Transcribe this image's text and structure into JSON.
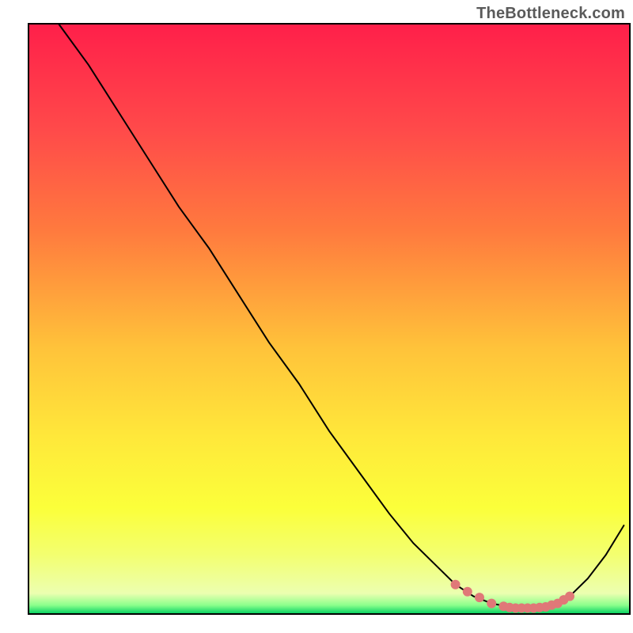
{
  "watermark": "TheBottleneck.com",
  "chart_data": {
    "type": "line",
    "title": "",
    "xlabel": "",
    "ylabel": "",
    "xlim": [
      0,
      100
    ],
    "ylim": [
      0,
      100
    ],
    "grid": false,
    "legend": false,
    "background_gradient": {
      "direction": "vertical",
      "stops": [
        {
          "offset": 0.0,
          "color": "#ff1f4a"
        },
        {
          "offset": 0.18,
          "color": "#ff4a4a"
        },
        {
          "offset": 0.35,
          "color": "#ff7a3e"
        },
        {
          "offset": 0.55,
          "color": "#ffc33a"
        },
        {
          "offset": 0.7,
          "color": "#ffe83a"
        },
        {
          "offset": 0.82,
          "color": "#fbff3a"
        },
        {
          "offset": 0.9,
          "color": "#f3ff70"
        },
        {
          "offset": 0.965,
          "color": "#ecffb0"
        },
        {
          "offset": 0.985,
          "color": "#8cff8c"
        },
        {
          "offset": 1.0,
          "color": "#00d060"
        }
      ]
    },
    "series": [
      {
        "name": "bottleneck-curve",
        "color": "#000000",
        "width": 2,
        "x": [
          5,
          10,
          15,
          20,
          25,
          30,
          35,
          40,
          45,
          50,
          55,
          60,
          64,
          68,
          71,
          74,
          77,
          80,
          82,
          84,
          86,
          88,
          90,
          93,
          96,
          99
        ],
        "values": [
          100,
          93,
          85,
          77,
          69,
          62,
          54,
          46,
          39,
          31,
          24,
          17,
          12,
          8,
          5,
          3,
          1.8,
          1.2,
          1.0,
          1.0,
          1.2,
          1.8,
          3,
          6,
          10,
          15
        ]
      }
    ],
    "highlight_band": {
      "name": "optimal-range",
      "color": "#e07878",
      "radius": 6,
      "x": [
        71,
        73,
        75,
        77,
        79,
        80,
        81,
        82,
        83,
        84,
        85,
        86,
        87,
        88,
        89,
        90
      ],
      "values": [
        5,
        3.8,
        2.8,
        1.8,
        1.3,
        1.1,
        1.0,
        1.0,
        1.0,
        1.0,
        1.1,
        1.2,
        1.5,
        1.8,
        2.4,
        3.0
      ]
    }
  }
}
